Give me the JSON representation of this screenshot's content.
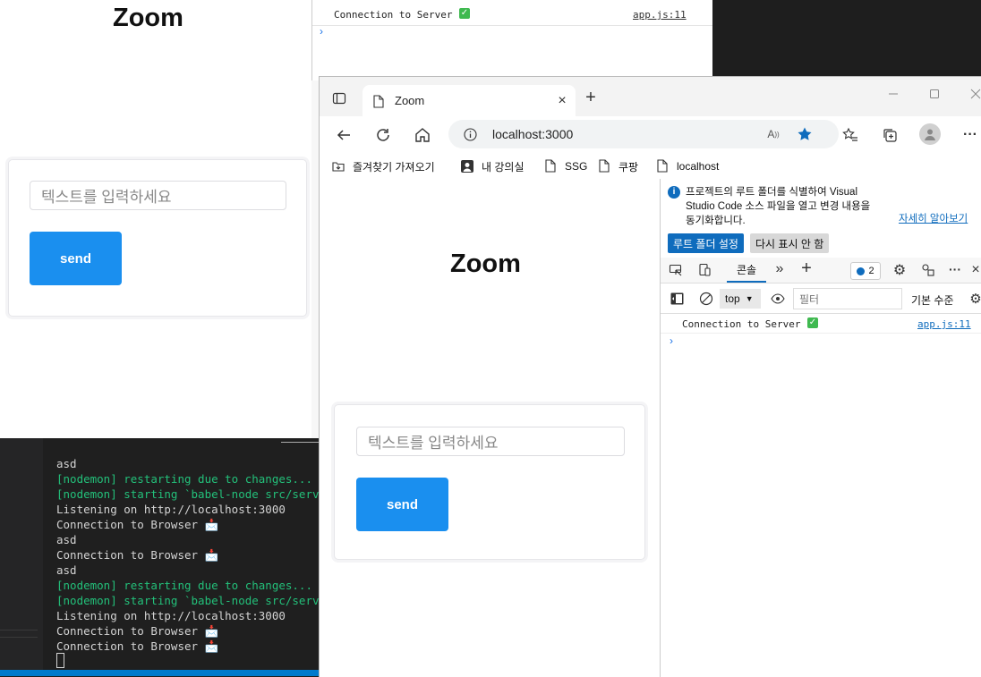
{
  "back_page": {
    "title": "Zoom",
    "input_placeholder": "텍스트를 입력하세요",
    "send_label": "send"
  },
  "back_devtools": {
    "log_text": "Connection to Server",
    "log_source": "app.js:11",
    "prompt": "›"
  },
  "terminal": {
    "lines": [
      {
        "text": "asd",
        "style": "normal"
      },
      {
        "text": "[nodemon] restarting due to changes...",
        "style": "green"
      },
      {
        "text": "[nodemon] starting `babel-node src/server.",
        "style": "green"
      },
      {
        "text": "Listening on http://localhost:3000",
        "style": "normal"
      },
      {
        "text": "Connection to Browser 📩",
        "style": "normal"
      },
      {
        "text": "asd",
        "style": "normal"
      },
      {
        "text": "Connection to Browser 📩",
        "style": "normal"
      },
      {
        "text": "asd",
        "style": "normal"
      },
      {
        "text": "[nodemon] restarting due to changes...",
        "style": "green"
      },
      {
        "text": "[nodemon] starting `babel-node src/server.",
        "style": "green"
      },
      {
        "text": "Listening on http://localhost:3000",
        "style": "normal"
      },
      {
        "text": "Connection to Browser 📩",
        "style": "normal"
      },
      {
        "text": "Connection to Browser 📩",
        "style": "normal"
      }
    ]
  },
  "browser": {
    "tab_title": "Zoom",
    "url": "localhost:3000",
    "favorites": [
      {
        "label": "즐겨찾기 가져오기",
        "icon": "import-icon"
      },
      {
        "label": "내 강의실",
        "icon": "account-icon"
      },
      {
        "label": "SSG",
        "icon": "page-icon"
      },
      {
        "label": "쿠팡",
        "icon": "page-icon"
      },
      {
        "label": "localhost",
        "icon": "page-icon"
      }
    ],
    "page": {
      "title": "Zoom",
      "input_placeholder": "텍스트를 입력하세요",
      "send_label": "send"
    }
  },
  "devtools": {
    "info_text_1": "프로젝트의 루트 폴더를 식별하여 Visual",
    "info_text_2": "Studio Code 소스 파일을 열고 변경 내용을",
    "info_text_3": "동기화합니다.",
    "learn_more": "자세히 알아보기",
    "set_root_button": "루트 폴더 설정",
    "dont_show_button": "다시 표시 안 함",
    "tab_console": "콘솔",
    "issues_count": "2",
    "context_value": "top",
    "filter_placeholder": "필터",
    "level_label": "기본 수준",
    "log_text": "Connection to Server",
    "log_source": "app.js:11",
    "prompt": "›"
  },
  "colors": {
    "accent": "#1a8fef",
    "edge_blue": "#0f6cbd",
    "terminal_green": "#23c07a"
  }
}
